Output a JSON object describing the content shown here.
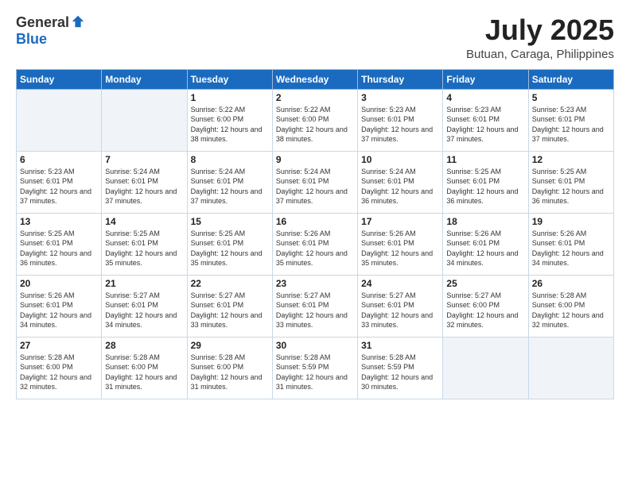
{
  "header": {
    "logo_general": "General",
    "logo_blue": "Blue",
    "month_year": "July 2025",
    "location": "Butuan, Caraga, Philippines"
  },
  "weekdays": [
    "Sunday",
    "Monday",
    "Tuesday",
    "Wednesday",
    "Thursday",
    "Friday",
    "Saturday"
  ],
  "weeks": [
    [
      {
        "day": "",
        "empty": true
      },
      {
        "day": "",
        "empty": true
      },
      {
        "day": "1",
        "sunrise": "5:22 AM",
        "sunset": "6:00 PM",
        "daylight": "12 hours and 38 minutes."
      },
      {
        "day": "2",
        "sunrise": "5:22 AM",
        "sunset": "6:00 PM",
        "daylight": "12 hours and 38 minutes."
      },
      {
        "day": "3",
        "sunrise": "5:23 AM",
        "sunset": "6:01 PM",
        "daylight": "12 hours and 37 minutes."
      },
      {
        "day": "4",
        "sunrise": "5:23 AM",
        "sunset": "6:01 PM",
        "daylight": "12 hours and 37 minutes."
      },
      {
        "day": "5",
        "sunrise": "5:23 AM",
        "sunset": "6:01 PM",
        "daylight": "12 hours and 37 minutes."
      }
    ],
    [
      {
        "day": "6",
        "sunrise": "5:23 AM",
        "sunset": "6:01 PM",
        "daylight": "12 hours and 37 minutes."
      },
      {
        "day": "7",
        "sunrise": "5:24 AM",
        "sunset": "6:01 PM",
        "daylight": "12 hours and 37 minutes."
      },
      {
        "day": "8",
        "sunrise": "5:24 AM",
        "sunset": "6:01 PM",
        "daylight": "12 hours and 37 minutes."
      },
      {
        "day": "9",
        "sunrise": "5:24 AM",
        "sunset": "6:01 PM",
        "daylight": "12 hours and 37 minutes."
      },
      {
        "day": "10",
        "sunrise": "5:24 AM",
        "sunset": "6:01 PM",
        "daylight": "12 hours and 36 minutes."
      },
      {
        "day": "11",
        "sunrise": "5:25 AM",
        "sunset": "6:01 PM",
        "daylight": "12 hours and 36 minutes."
      },
      {
        "day": "12",
        "sunrise": "5:25 AM",
        "sunset": "6:01 PM",
        "daylight": "12 hours and 36 minutes."
      }
    ],
    [
      {
        "day": "13",
        "sunrise": "5:25 AM",
        "sunset": "6:01 PM",
        "daylight": "12 hours and 36 minutes."
      },
      {
        "day": "14",
        "sunrise": "5:25 AM",
        "sunset": "6:01 PM",
        "daylight": "12 hours and 35 minutes."
      },
      {
        "day": "15",
        "sunrise": "5:25 AM",
        "sunset": "6:01 PM",
        "daylight": "12 hours and 35 minutes."
      },
      {
        "day": "16",
        "sunrise": "5:26 AM",
        "sunset": "6:01 PM",
        "daylight": "12 hours and 35 minutes."
      },
      {
        "day": "17",
        "sunrise": "5:26 AM",
        "sunset": "6:01 PM",
        "daylight": "12 hours and 35 minutes."
      },
      {
        "day": "18",
        "sunrise": "5:26 AM",
        "sunset": "6:01 PM",
        "daylight": "12 hours and 34 minutes."
      },
      {
        "day": "19",
        "sunrise": "5:26 AM",
        "sunset": "6:01 PM",
        "daylight": "12 hours and 34 minutes."
      }
    ],
    [
      {
        "day": "20",
        "sunrise": "5:26 AM",
        "sunset": "6:01 PM",
        "daylight": "12 hours and 34 minutes."
      },
      {
        "day": "21",
        "sunrise": "5:27 AM",
        "sunset": "6:01 PM",
        "daylight": "12 hours and 34 minutes."
      },
      {
        "day": "22",
        "sunrise": "5:27 AM",
        "sunset": "6:01 PM",
        "daylight": "12 hours and 33 minutes."
      },
      {
        "day": "23",
        "sunrise": "5:27 AM",
        "sunset": "6:01 PM",
        "daylight": "12 hours and 33 minutes."
      },
      {
        "day": "24",
        "sunrise": "5:27 AM",
        "sunset": "6:01 PM",
        "daylight": "12 hours and 33 minutes."
      },
      {
        "day": "25",
        "sunrise": "5:27 AM",
        "sunset": "6:00 PM",
        "daylight": "12 hours and 32 minutes."
      },
      {
        "day": "26",
        "sunrise": "5:28 AM",
        "sunset": "6:00 PM",
        "daylight": "12 hours and 32 minutes."
      }
    ],
    [
      {
        "day": "27",
        "sunrise": "5:28 AM",
        "sunset": "6:00 PM",
        "daylight": "12 hours and 32 minutes."
      },
      {
        "day": "28",
        "sunrise": "5:28 AM",
        "sunset": "6:00 PM",
        "daylight": "12 hours and 31 minutes."
      },
      {
        "day": "29",
        "sunrise": "5:28 AM",
        "sunset": "6:00 PM",
        "daylight": "12 hours and 31 minutes."
      },
      {
        "day": "30",
        "sunrise": "5:28 AM",
        "sunset": "5:59 PM",
        "daylight": "12 hours and 31 minutes."
      },
      {
        "day": "31",
        "sunrise": "5:28 AM",
        "sunset": "5:59 PM",
        "daylight": "12 hours and 30 minutes."
      },
      {
        "day": "",
        "empty": true
      },
      {
        "day": "",
        "empty": true
      }
    ]
  ]
}
